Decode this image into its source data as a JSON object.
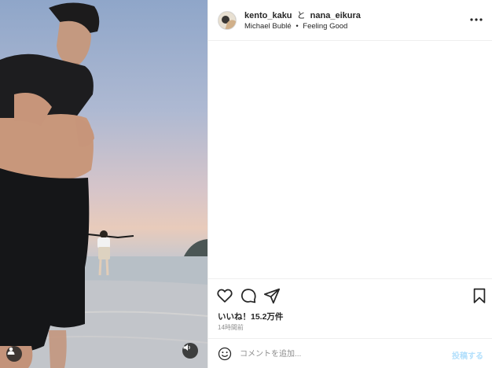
{
  "post": {
    "authors": [
      "kento_kaku",
      "nana_eikura"
    ],
    "author_separator": "と",
    "audio_artist": "Michael Bublé",
    "audio_dot": "•",
    "audio_track": "Feeling Good",
    "more_icon": "more-horizontal-icon"
  },
  "media": {
    "description_icon_tag": "user-tag-icon",
    "mute_icon": "speaker-icon"
  },
  "actions": {
    "like_icon": "heart-icon",
    "comment_icon": "comment-icon",
    "share_icon": "paper-plane-icon",
    "save_icon": "bookmark-icon",
    "likes_text": "いいね！15.2万件",
    "time_text": "14時間前"
  },
  "comment_bar": {
    "emoji_icon": "emoji-icon",
    "placeholder": "コメントを追加...",
    "post_label": "投稿する",
    "post_color": "#b2dffc"
  }
}
